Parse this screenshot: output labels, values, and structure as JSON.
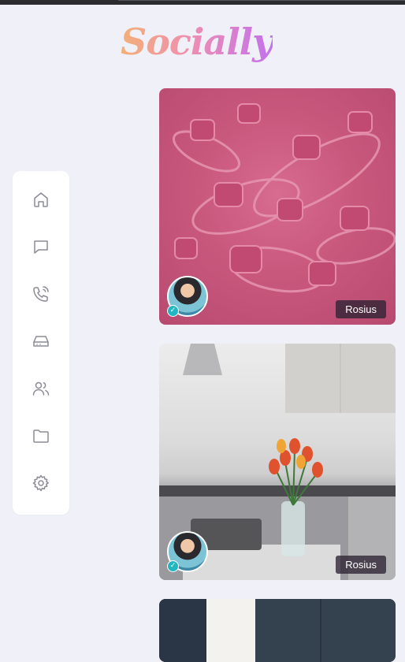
{
  "app": {
    "logo": "Socially"
  },
  "sidebar": {
    "items": [
      {
        "icon": "home-icon",
        "name": "home"
      },
      {
        "icon": "chat-icon",
        "name": "messages"
      },
      {
        "icon": "phone-icon",
        "name": "calls"
      },
      {
        "icon": "storage-icon",
        "name": "storage"
      },
      {
        "icon": "users-icon",
        "name": "people"
      },
      {
        "icon": "folder-icon",
        "name": "files"
      },
      {
        "icon": "gear-icon",
        "name": "settings"
      }
    ]
  },
  "feed": {
    "posts": [
      {
        "author": "Rosius",
        "image": "pink abstract 3D shapes",
        "verified": true
      },
      {
        "author": "Rosius",
        "image": "kitchen with tulips in vase",
        "verified": true
      },
      {
        "author": "",
        "image": "dark interior",
        "verified": false
      }
    ]
  },
  "colors": {
    "background": "#f0f1f8",
    "sidebar": "#ffffff",
    "icon": "#8a8b95",
    "badge": "#2d2332",
    "verified": "#22b6c2"
  }
}
